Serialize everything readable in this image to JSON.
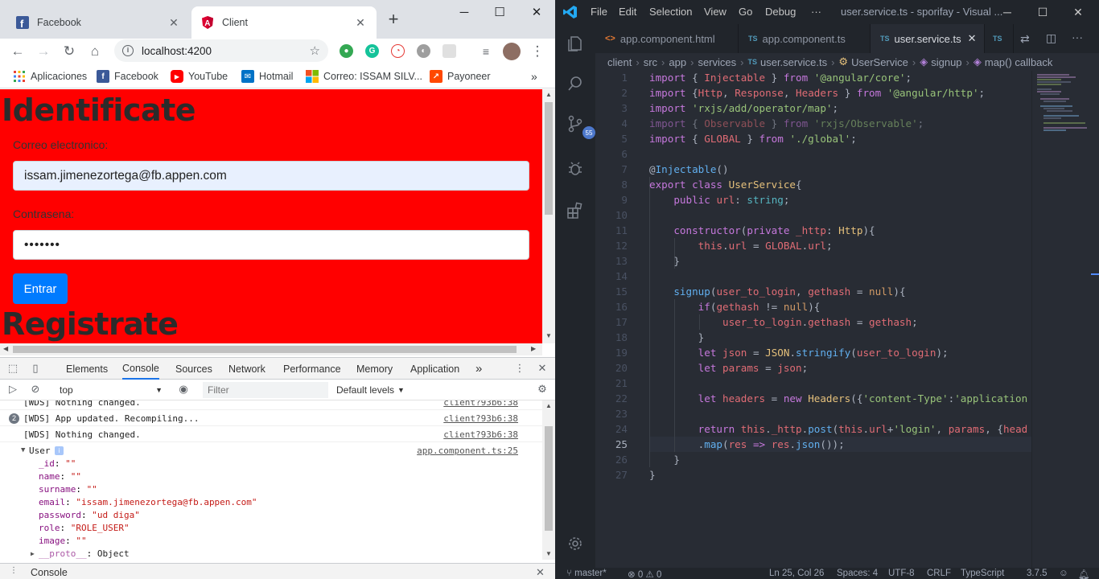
{
  "chrome": {
    "tabs": [
      {
        "label": "Facebook",
        "favicon": "facebook-icon"
      },
      {
        "label": "Client",
        "favicon": "angular-icon"
      }
    ],
    "url": "localhost:4200",
    "bookmarks": [
      {
        "label": "Aplicaciones",
        "icon": "apps-grid-icon"
      },
      {
        "label": "Facebook",
        "icon": "facebook-icon"
      },
      {
        "label": "YouTube",
        "icon": "youtube-icon"
      },
      {
        "label": "Hotmail",
        "icon": "hotmail-icon"
      },
      {
        "label": "Correo: ISSAM SILV...",
        "icon": "outlook-icon"
      },
      {
        "label": "Payoneer",
        "icon": "payoneer-icon"
      }
    ],
    "bookmarks_more": "»",
    "colors": {
      "page_bg": "#ff0000",
      "button": "#007bff",
      "accent": "#1a73e8"
    }
  },
  "page": {
    "login_heading": "Identificate",
    "email_label": "Correo electronico:",
    "email_value": "issam.jimenezortega@fb.appen.com",
    "password_label": "Contrasena:",
    "password_value": "•••••••",
    "submit_label": "Entrar",
    "register_heading": "Registrate"
  },
  "devtools": {
    "tabs": [
      "Elements",
      "Console",
      "Sources",
      "Network",
      "Performance",
      "Memory",
      "Application"
    ],
    "more": "»",
    "context": "top",
    "filter_placeholder": "Filter",
    "levels": "Default levels",
    "logs": [
      {
        "msg": "[WDS] Nothing changed.",
        "src": "client?93b6:38"
      },
      {
        "badge": "2",
        "msg": "[WDS] App updated. Recompiling...",
        "src": "client?93b6:38"
      },
      {
        "msg": "[WDS] Nothing changed.",
        "src": "client?93b6:38"
      }
    ],
    "object_log": {
      "name": "User",
      "info": "i",
      "src": "app.component.ts:25",
      "props": [
        {
          "key": "_id",
          "value": "\"\""
        },
        {
          "key": "name",
          "value": "\"\""
        },
        {
          "key": "surname",
          "value": "\"\""
        },
        {
          "key": "email",
          "value": "\"issam.jimenezortega@fb.appen.com\""
        },
        {
          "key": "password",
          "value": "\"ud diga\""
        },
        {
          "key": "role",
          "value": "\"ROLE_USER\""
        },
        {
          "key": "image",
          "value": "\"\""
        }
      ],
      "proto_key": "__proto__",
      "proto_value": "Object"
    },
    "drawer_label": "Console"
  },
  "vscode": {
    "menu": [
      "File",
      "Edit",
      "Selection",
      "View",
      "Go",
      "Debug",
      "···"
    ],
    "title": "user.service.ts - sporifay - Visual ...",
    "scm_badge": "55",
    "tabs": [
      {
        "label": "app.component.html",
        "icon": "html-icon"
      },
      {
        "label": "app.component.ts",
        "icon": "ts-icon"
      },
      {
        "label": "user.service.ts",
        "icon": "ts-icon",
        "active": true
      }
    ],
    "breadcrumb": [
      "client",
      "src",
      "app",
      "services",
      "user.service.ts",
      "UserService",
      "signup",
      "map() callback"
    ],
    "status": {
      "branch": "master*",
      "errors": "0",
      "warnings": "0",
      "position": "Ln 25, Col 26",
      "spaces": "Spaces: 4",
      "encoding": "UTF-8",
      "eol": "CRLF",
      "language": "TypeScript",
      "version": "3.7.5"
    }
  }
}
